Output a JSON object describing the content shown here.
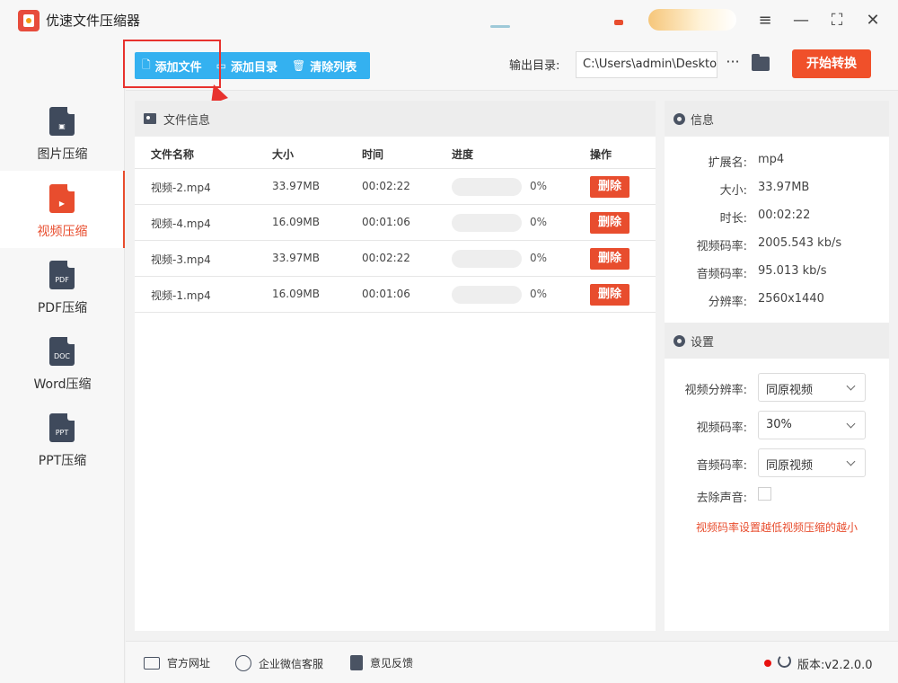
{
  "app": {
    "title": "优速文件压缩器"
  },
  "sidebar": {
    "items": [
      {
        "label": "图片压缩",
        "icon": "image-file-icon",
        "glyph": "▣",
        "active": false
      },
      {
        "label": "视频压缩",
        "icon": "video-file-icon",
        "glyph": "▶",
        "active": true
      },
      {
        "label": "PDF压缩",
        "icon": "pdf-file-icon",
        "glyph": "PDF",
        "active": false
      },
      {
        "label": "Word压缩",
        "icon": "doc-file-icon",
        "glyph": "DOC",
        "active": false
      },
      {
        "label": "PPT压缩",
        "icon": "ppt-file-icon",
        "glyph": "PPT",
        "active": false
      }
    ]
  },
  "toolbar": {
    "add_file": "添加文件",
    "add_dir": "添加目录",
    "clear_list": "清除列表",
    "output_label": "输出目录:",
    "output_path": "C:\\Users\\admin\\Deskto",
    "more": "···",
    "start": "开始转换",
    "accent": "#34b1f0",
    "start_color": "#f0502a"
  },
  "file_panel": {
    "title": "文件信息",
    "columns": {
      "name": "文件名称",
      "size": "大小",
      "time": "时间",
      "progress": "进度",
      "action": "操作"
    },
    "rows": [
      {
        "name": "视频-2.mp4",
        "size": "33.97MB",
        "time": "00:02:22",
        "progress": 0,
        "pct": "0%",
        "action": "删除"
      },
      {
        "name": "视频-4.mp4",
        "size": "16.09MB",
        "time": "00:01:06",
        "progress": 0,
        "pct": "0%",
        "action": "删除"
      },
      {
        "name": "视频-3.mp4",
        "size": "33.97MB",
        "time": "00:02:22",
        "progress": 0,
        "pct": "0%",
        "action": "删除"
      },
      {
        "name": "视频-1.mp4",
        "size": "16.09MB",
        "time": "00:01:06",
        "progress": 0,
        "pct": "0%",
        "action": "删除"
      }
    ]
  },
  "info": {
    "title": "信息",
    "fields": [
      {
        "key": "扩展名:",
        "value": "mp4"
      },
      {
        "key": "大小:",
        "value": "33.97MB"
      },
      {
        "key": "时长:",
        "value": "00:02:22"
      },
      {
        "key": "视频码率:",
        "value": "2005.543 kb/s"
      },
      {
        "key": "音频码率:",
        "value": "95.013 kb/s"
      },
      {
        "key": "分辨率:",
        "value": "2560x1440"
      }
    ]
  },
  "settings": {
    "title": "设置",
    "video_res_label": "视频分辨率:",
    "video_res_value": "同原视频",
    "video_bitrate_label": "视频码率:",
    "video_bitrate_value": "30%",
    "audio_bitrate_label": "音频码率:",
    "audio_bitrate_value": "同原视频",
    "mute_label": "去除声音:",
    "mute_checked": false,
    "hint": "视频码率设置越低视频压缩的越小"
  },
  "footer": {
    "website": "官方网址",
    "wechat": "企业微信客服",
    "feedback": "意见反馈",
    "version": "版本:v2.2.0.0"
  }
}
